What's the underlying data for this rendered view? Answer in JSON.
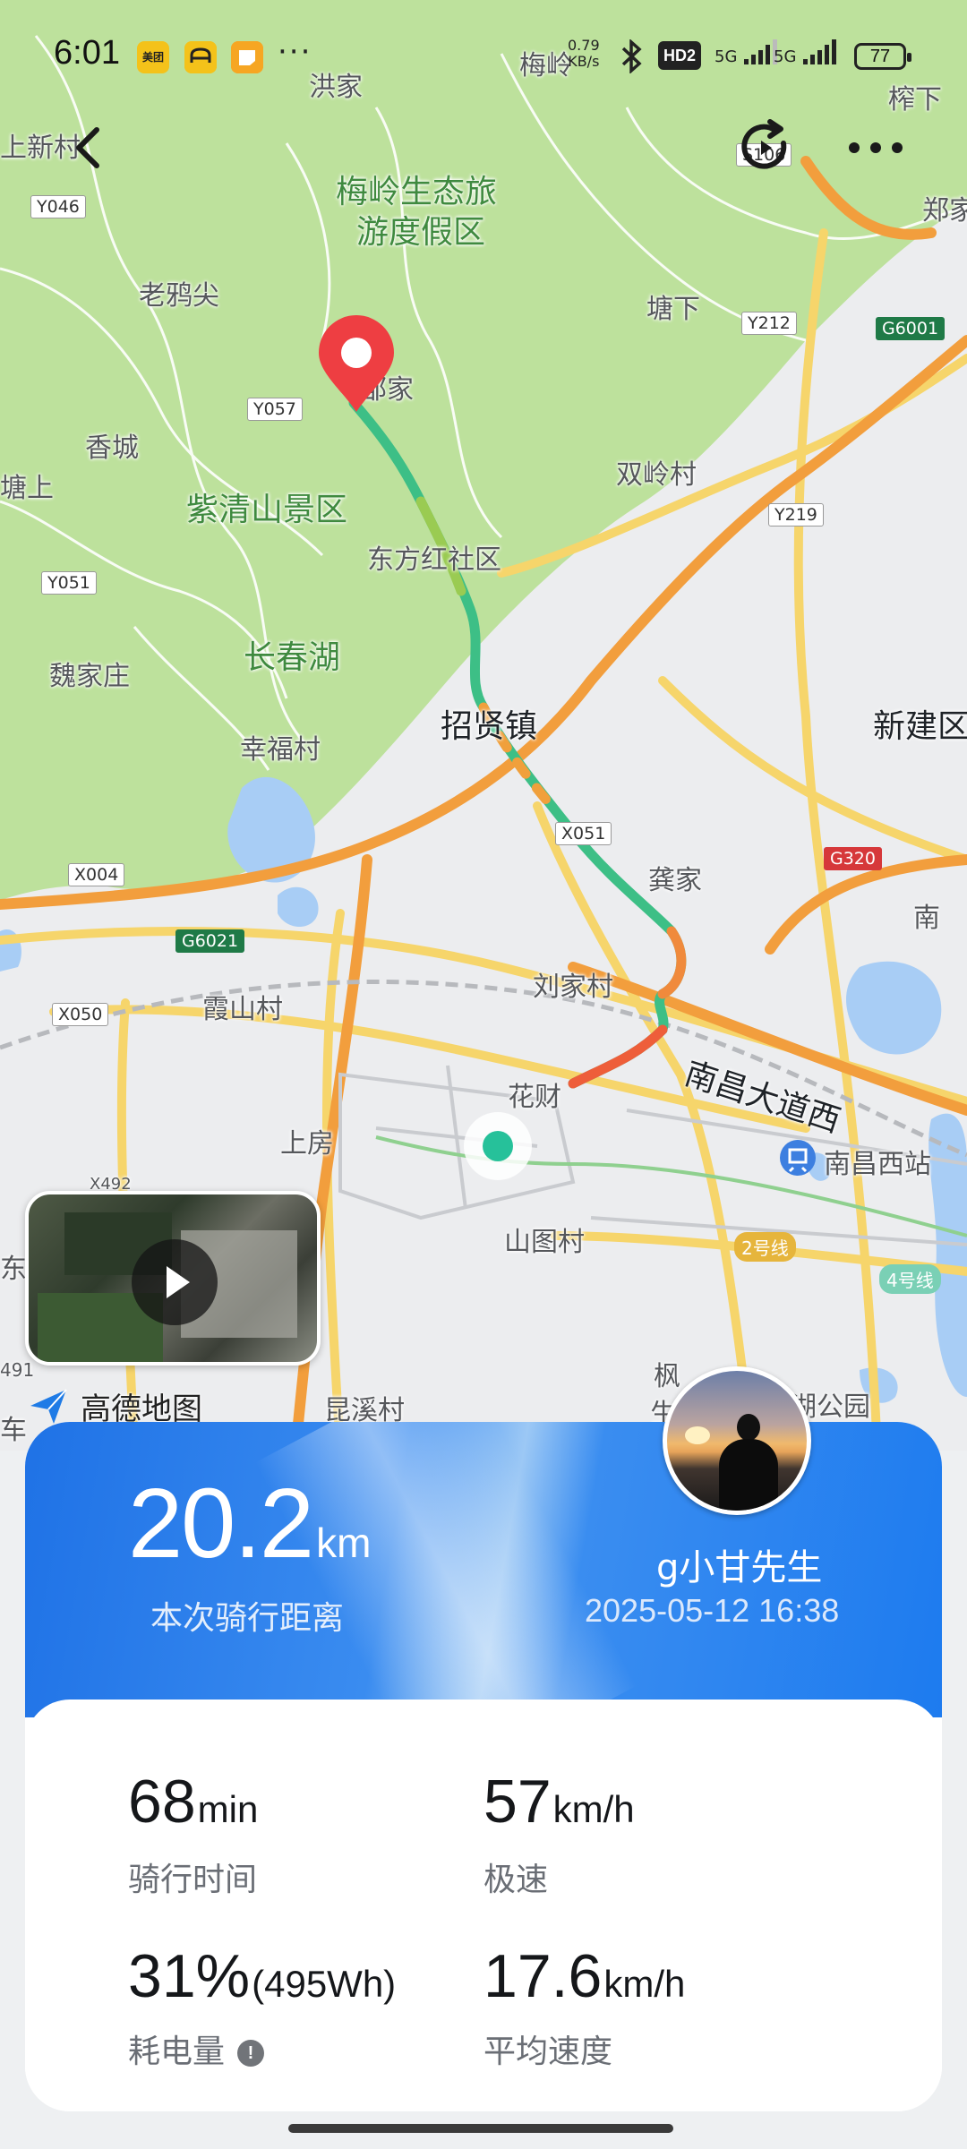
{
  "status_bar": {
    "time": "6:01",
    "app_icons": [
      "美团",
      "",
      ""
    ],
    "more": "···",
    "net_speed": "0.79",
    "net_unit": "KB/s",
    "hd": "HD2",
    "sig1": "5G",
    "sig2": "5G",
    "battery": "77"
  },
  "map": {
    "labels": {
      "hongjia": "洪家",
      "meiling_top": "梅岭",
      "zhaxia": "榨下",
      "shangxin": "上新村",
      "zhengjia": "郑家",
      "meiling_resort_1": "梅岭生态旅",
      "meiling_resort_2": "游度假区",
      "laoyajian": "老鸦尖",
      "tangxia": "塘下",
      "xiangcheng": "香城",
      "zijia": "邹家",
      "shuangling": "双岭村",
      "ziqingshan": "紫清山景区",
      "dongfanghong": "东方红社区",
      "changchunhu": "长春湖",
      "weijiazhuang": "魏家庄",
      "zhaoxian": "招贤镇",
      "xinjian": "新建区",
      "xingfu": "幸福村",
      "gongjia": "龚家",
      "liujia": "刘家村",
      "xiashan": "霞山村",
      "huacai": "花财",
      "nanchang_ave": "南昌大道西",
      "nanchang_west": "南昌西站",
      "shangfang": "上房",
      "shantu": "山图村",
      "kunxi": "昆溪村",
      "feng": "枫",
      "sheng": "生",
      "hupark": "湖公园",
      "nan": "南",
      "sheng_left": "塘上",
      "dong_left": "东",
      "d491": "491",
      "che": "车",
      "x492": "X492"
    },
    "road_tags": {
      "y046": "Y046",
      "y057": "Y057",
      "y051": "Y051",
      "y212": "Y212",
      "y219": "Y219",
      "g6001": "G6001",
      "x051": "X051",
      "g320": "G320",
      "x004": "X004",
      "g6021": "G6021",
      "x050": "X050",
      "s106": "S106"
    },
    "metro": {
      "line2": "2号线",
      "line4": "4号线"
    },
    "logo_text": "高德地图"
  },
  "ride": {
    "distance_value": "20.2",
    "distance_unit": "km",
    "distance_label": "本次骑行距离",
    "username": "g小甘先生",
    "datetime": "2025-05-12 16:38",
    "stats": {
      "duration_value": "68",
      "duration_unit": "min",
      "duration_label": "骑行时间",
      "top_speed_value": "57",
      "top_speed_unit": "km/h",
      "top_speed_label": "极速",
      "energy_value": "31%",
      "energy_extra": "(495Wh)",
      "energy_label": "耗电量",
      "avg_speed_value": "17.6",
      "avg_speed_unit": "km/h",
      "avg_speed_label": "平均速度"
    }
  },
  "colors": {
    "card_blue": "#1f72e6",
    "route_green": "#3dbf86",
    "route_orange": "#f08a3c",
    "pin_red": "#ee3e42",
    "map_green": "#b9df98"
  },
  "icons": [
    "back-arrow-icon",
    "replay-icon",
    "more-dots-icon",
    "location-pin-icon",
    "current-location-icon",
    "play-icon",
    "amap-logo-icon",
    "info-icon",
    "train-station-icon"
  ]
}
